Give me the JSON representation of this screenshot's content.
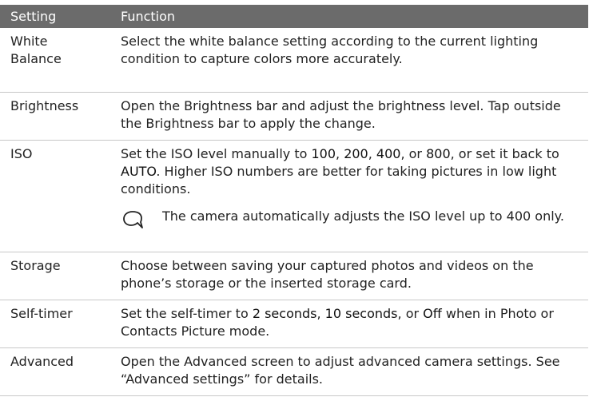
{
  "table": {
    "headers": [
      "Setting",
      "Function"
    ],
    "rows": [
      {
        "name": "White Balance",
        "description": "Select the white balance setting according to the current lighting condition to capture colors more accurately."
      },
      {
        "name": "Brightness",
        "description": "Open the Brightness bar and adjust the brightness level. Tap outside the Brightness bar to apply the change."
      },
      {
        "name": "ISO",
        "description_parts": [
          "Set the ISO level manually to ",
          "100",
          ", ",
          "200",
          ", ",
          "400",
          ", or ",
          "800",
          ", or set it back to ",
          "AUTO",
          ". Higher ISO numbers are better for taking pictures in low light conditions."
        ],
        "note_icon": "note-icon",
        "note": "The camera automatically adjusts the ISO level up to 400 only."
      },
      {
        "name": "Storage",
        "description": "Choose between saving your captured photos and videos on the phone’s storage or the inserted storage card."
      },
      {
        "name": "Self-timer",
        "description_parts": [
          "Set the self-timer to ",
          "2 seconds",
          ", ",
          "10 seconds",
          ", or ",
          "Off",
          " when in Photo or Contacts Picture mode."
        ]
      },
      {
        "name": "Advanced",
        "description": "Open the Advanced screen to adjust advanced camera settings. See “Advanced settings” for details."
      }
    ]
  },
  "colors": {
    "header_bg": "#6b6b6b",
    "header_text": "#ffffff",
    "rule": "#c8c8c8",
    "text": "#222222"
  }
}
